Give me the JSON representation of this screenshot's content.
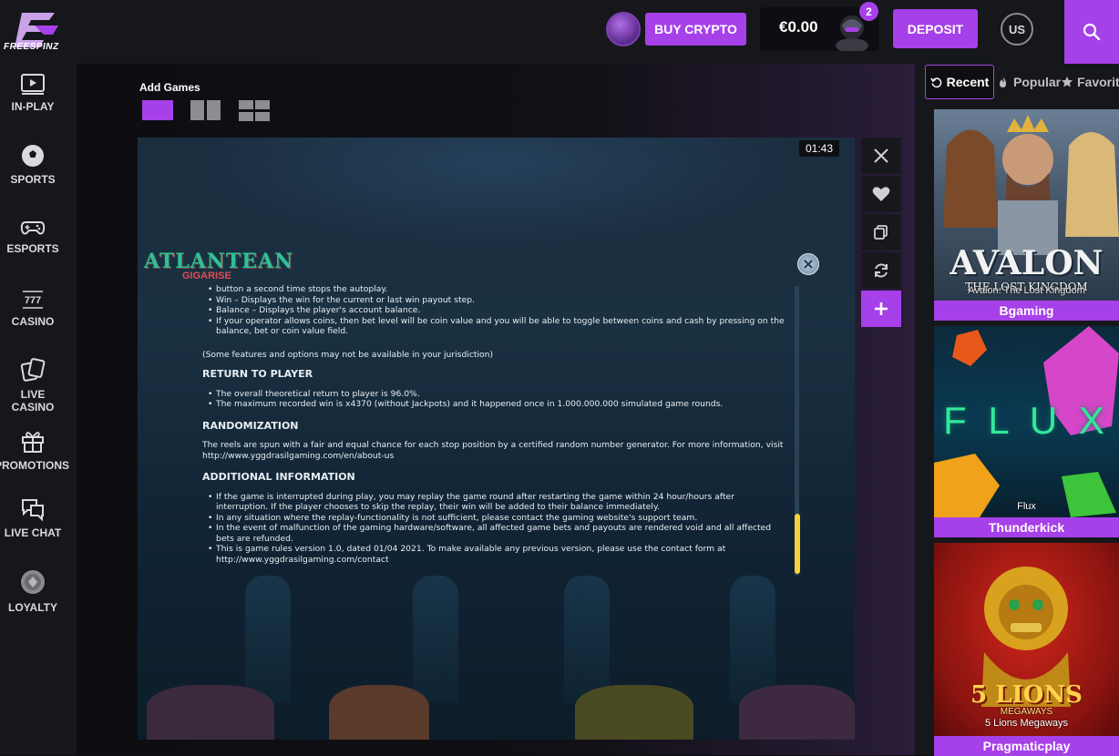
{
  "brand": {
    "name": "FREESPINZ"
  },
  "header": {
    "buy_crypto_label": "BUY CRYPTO",
    "balance": "€0.00",
    "notification_count": "2",
    "deposit_label": "DEPOSIT",
    "language": "US"
  },
  "sidebar": {
    "items": [
      {
        "label": "IN-PLAY",
        "icon": "play-screen-icon"
      },
      {
        "label": "SPORTS",
        "icon": "soccer-ball-icon"
      },
      {
        "label": "ESPORTS",
        "icon": "gamepad-icon"
      },
      {
        "label": "CASINO",
        "icon": "slot-777-icon"
      },
      {
        "label": "LIVE CASINO",
        "icon": "cards-icon"
      },
      {
        "label": "PROMOTIONS",
        "icon": "gift-icon"
      },
      {
        "label": "LIVE CHAT",
        "icon": "chat-bubbles-icon"
      },
      {
        "label": "LOYALTY",
        "icon": "loyalty-coin-icon"
      }
    ]
  },
  "main": {
    "add_games_label": "Add Games",
    "timer": "01:43",
    "game_logo": "ATLANTEAN",
    "game_logo_sub": "GIGARISE",
    "rules": {
      "intro_items": [
        "button a second time stops the autoplay.",
        "Win – Displays the win for the current or last win payout step.",
        "Balance – Displays the player's account balance.",
        "If your operator allows coins, then bet level will be coin value and you will be able to toggle between coins and cash by pressing on the balance, bet or coin value field."
      ],
      "note": "(Some features and options may not be available in your jurisdiction)",
      "rtp_heading": "RETURN TO PLAYER",
      "rtp_items": [
        "The overall theoretical return to player is 96.0%.",
        "The maximum recorded win is x4370 (without Jackpots) and it happened once in 1.000.000.000 simulated game rounds."
      ],
      "random_heading": "RANDOMIZATION",
      "random_text": "The reels are spun with a fair and equal chance for each stop position by a certified random number generator. For more information, visit http://www.yggdrasilgaming.com/en/about-us",
      "additional_heading": "ADDITIONAL INFORMATION",
      "additional_items": [
        "If the game is interrupted during play, you may replay the game round after restarting the game within 24 hour/hours after interruption. If the player chooses to skip the replay, their win will be added to their balance immediately.",
        "In any situation where the replay-functionality is not sufficient, please contact the gaming website's support team.",
        "In the event of malfunction of the gaming hardware/software, all affected game bets and payouts are rendered void and all affected bets are refunded.",
        "This is game rules version 1.0, dated 01/04 2021. To make available any previous version, please use the contact form at http://www.yggdrasilgaming.com/contact"
      ]
    }
  },
  "right_panel": {
    "tabs": [
      "Recent",
      "Popular",
      "Favorit"
    ],
    "games": [
      {
        "title_art": "AVALON",
        "subtitle_art": "THE LOST KINGDOM",
        "caption": "Avalon: The Lost Kingdom",
        "provider": "Bgaming"
      },
      {
        "title_art": "F L U X",
        "caption": "Flux",
        "provider": "Thunderkick"
      },
      {
        "title_art": "5 LIONS",
        "subtitle_art": "MEGAWAYS",
        "caption": "5 Lions Megaways",
        "provider": "Pragmaticplay"
      }
    ]
  },
  "colors": {
    "accent": "#a640e8",
    "background": "#0e0f12",
    "panel": "#16171b",
    "scroll_thumb": "#f5d13a"
  }
}
